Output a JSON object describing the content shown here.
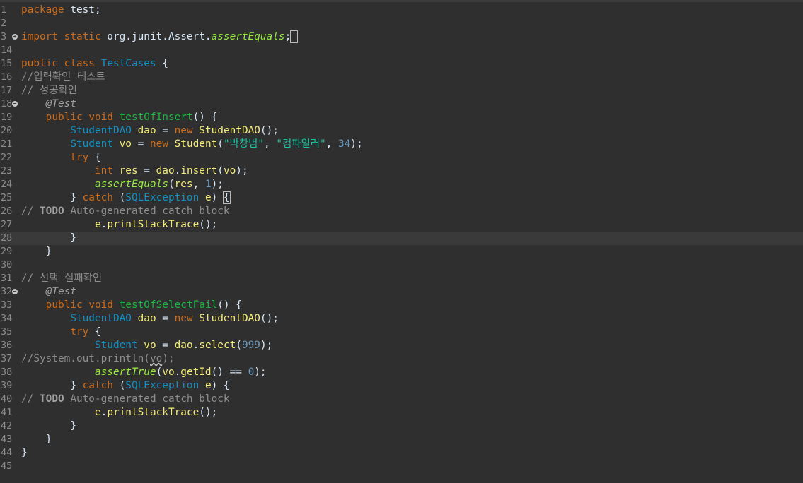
{
  "editor": {
    "lines": [
      {
        "n": "1",
        "html": "<span class=\"kw\">package</span> test;"
      },
      {
        "n": "2",
        "html": ""
      },
      {
        "n": "3",
        "fold": "+",
        "html": "<span class=\"kw\">import</span> <span class=\"kw\">static</span> org.junit.Assert.<span class=\"static\">assertEquals</span>;<span class=\"br\"> </span>"
      },
      {
        "n": "14",
        "html": ""
      },
      {
        "n": "15",
        "html": "<span class=\"kw\">public</span> <span class=\"kw\">class</span> <span class=\"type\">TestCases</span> {"
      },
      {
        "n": "16",
        "html": "<span class=\"cmt\">//입력확인 테스트</span>"
      },
      {
        "n": "17",
        "html": "<span class=\"cmt\">// 성공확인</span>"
      },
      {
        "n": "18",
        "fold": "−",
        "html": "    <span class=\"ann\">@Test</span>"
      },
      {
        "n": "19",
        "html": "    <span class=\"kw\">public</span> <span class=\"kw\">void</span> <span class=\"mth\">testOfInsert</span>() {"
      },
      {
        "n": "20",
        "html": "        <span class=\"type\">StudentDAO</span> <span class=\"var\">dao</span> = <span class=\"kw\">new</span> <span class=\"var\">StudentDAO</span>();"
      },
      {
        "n": "21",
        "html": "        <span class=\"type\">Student</span> <span class=\"var\">vo</span> = <span class=\"kw\">new</span> <span class=\"var\">Student</span>(<span class=\"str\">\"박창범\"</span>, <span class=\"str\">\"컴파일러\"</span>, <span class=\"num\">34</span>);"
      },
      {
        "n": "22",
        "html": "        <span class=\"kw\">try</span> {"
      },
      {
        "n": "23",
        "html": "            <span class=\"kw\">int</span> <span class=\"var\">res</span> = <span class=\"var\">dao</span>.<span class=\"var\">insert</span>(<span class=\"var\">vo</span>);"
      },
      {
        "n": "24",
        "html": "            <span class=\"static\">assertEquals</span>(<span class=\"var\">res</span>, <span class=\"num\">1</span>);"
      },
      {
        "n": "25",
        "html": "        } <span class=\"kw\">catch</span> (<span class=\"type\">SQLException</span> <span class=\"var\">e</span>) <span class=\"br\">{</span>"
      },
      {
        "n": "26",
        "html": "<span class=\"cmt\">// </span><span class=\"todo\">TODO</span><span class=\"cmt\"> Auto-generated catch block</span>"
      },
      {
        "n": "27",
        "html": "            <span class=\"var\">e</span>.<span class=\"var\">printStackTrace</span>();"
      },
      {
        "n": "28",
        "current": true,
        "html": "        }"
      },
      {
        "n": "29",
        "html": "    }"
      },
      {
        "n": "30",
        "html": ""
      },
      {
        "n": "31",
        "html": "<span class=\"cmt\">// 선택 실패확인</span>"
      },
      {
        "n": "32",
        "fold": "−",
        "html": "    <span class=\"ann\">@Test</span>"
      },
      {
        "n": "33",
        "html": "    <span class=\"kw\">public</span> <span class=\"kw\">void</span> <span class=\"mth\">testOfSelectFail</span>() {"
      },
      {
        "n": "34",
        "html": "        <span class=\"type\">StudentDAO</span> <span class=\"var\">dao</span> = <span class=\"kw\">new</span> <span class=\"var\">StudentDAO</span>();"
      },
      {
        "n": "35",
        "html": "        <span class=\"kw\">try</span> {"
      },
      {
        "n": "36",
        "html": "            <span class=\"type\">Student</span> <span class=\"var\">vo</span> = <span class=\"var\">dao</span>.<span class=\"var\">select</span>(<span class=\"num\">999</span>);"
      },
      {
        "n": "37",
        "html": "<span class=\"cmt\">//System.out.println(<span class=\"squiggle\">vo</span>);</span>"
      },
      {
        "n": "38",
        "html": "            <span class=\"static\">assertTrue</span>(<span class=\"var\">vo</span>.<span class=\"var\">getId</span>() == <span class=\"num\">0</span>);"
      },
      {
        "n": "39",
        "html": "        } <span class=\"kw\">catch</span> (<span class=\"type\">SQLException</span> <span class=\"var\">e</span>) {"
      },
      {
        "n": "40",
        "html": "<span class=\"cmt\">// </span><span class=\"todo\">TODO</span><span class=\"cmt\"> Auto-generated catch block</span>"
      },
      {
        "n": "41",
        "html": "            <span class=\"var\">e</span>.<span class=\"var\">printStackTrace</span>();"
      },
      {
        "n": "42",
        "html": "        }"
      },
      {
        "n": "43",
        "html": "    }"
      },
      {
        "n": "44",
        "html": "}"
      },
      {
        "n": "45",
        "html": ""
      }
    ]
  },
  "colors": {
    "background": "#2f2f2f",
    "keyword": "#cc6c1d",
    "type": "#1290c3",
    "method_decl": "#1eb540",
    "variable": "#f3ec79",
    "string": "#17c6a3",
    "number": "#6897bb",
    "comment": "#8d8d8d",
    "current_line": "#3a3a3a"
  }
}
